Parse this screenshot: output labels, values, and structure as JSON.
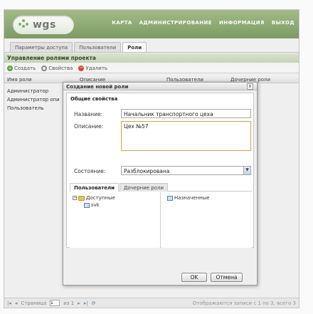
{
  "app": {
    "logo_text": "wgs",
    "nav": [
      "КАРТА",
      "АДМИНИСТРИРОВАНИЕ",
      "ИНФОРМАЦИЯ",
      "ВЫХОД"
    ]
  },
  "tabs": [
    "Параметры доступа",
    "Пользователи",
    "Роли"
  ],
  "panel": {
    "title": "Управление ролями проекта",
    "toolbar": {
      "create": "Создать",
      "properties": "Свойства",
      "delete": "Удалить"
    },
    "columns": [
      "Имя роли",
      "Описание",
      "Пользователи",
      "Дочерние роли"
    ],
    "rows": [
      "Администратор",
      "Администратор опи",
      "Пользователь"
    ]
  },
  "pager": {
    "page_label": "Страница",
    "page_value": "1",
    "of_label": "из 1",
    "info": "Отображаются записи с 1 по 3, всего 3"
  },
  "dialog": {
    "title": "Создание новой роли",
    "close": "x",
    "section_title": "Общие свойства",
    "name_label": "Название:",
    "name_value": "Начальник транспортного цеха",
    "desc_label": "Описание:",
    "desc_value": "Цех №57",
    "state_label": "Состояние:",
    "state_value": "Разблокирована",
    "subtabs": [
      "Пользователи",
      "Дочерние роли"
    ],
    "tree_available": "Доступные",
    "tree_user": "svk",
    "tree_assigned": "Назначенные",
    "ok": "OK",
    "cancel": "Отмена"
  }
}
